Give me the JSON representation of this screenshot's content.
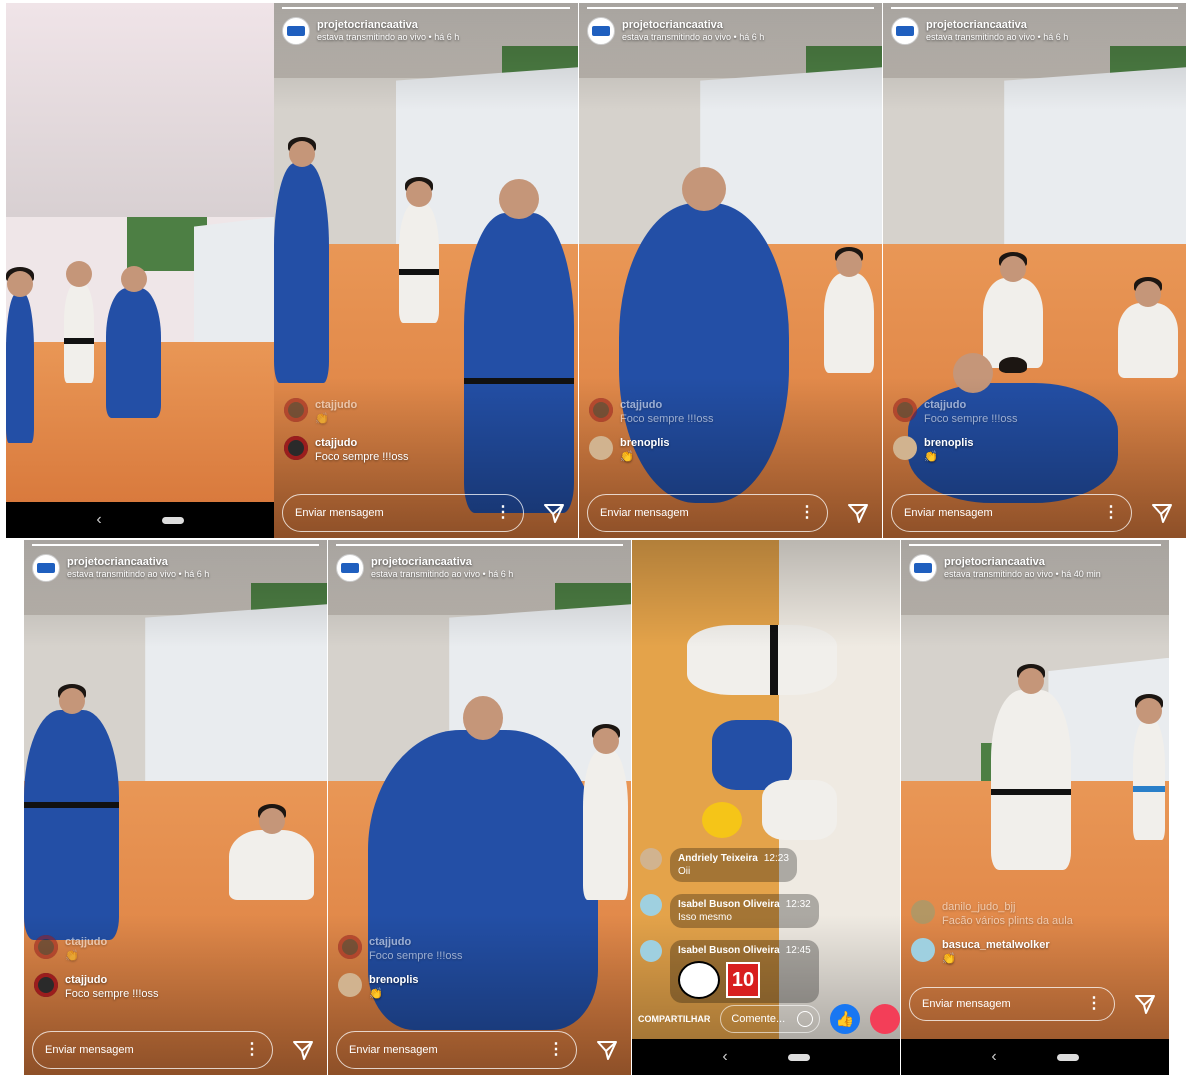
{
  "account": {
    "username": "projetocriancaativa",
    "status_6h": "estava transmitindo ao vivo • há 6 h",
    "status_40m": "estava transmitindo ao vivo • há 40 min"
  },
  "composer": {
    "placeholder": "Enviar mensagem"
  },
  "panel2": {
    "comments": [
      {
        "user": "ctajjudo",
        "text": "👏"
      },
      {
        "user": "ctajjudo",
        "text": "Foco sempre !!!oss"
      }
    ]
  },
  "panel3": {
    "comments": [
      {
        "user": "ctajjudo",
        "text": "Foco sempre !!!oss"
      },
      {
        "user": "brenoplis",
        "text": "👏"
      }
    ]
  },
  "panel4": {
    "comments": [
      {
        "user": "ctajjudo",
        "text": "Foco sempre !!!oss"
      },
      {
        "user": "brenoplis",
        "text": "👏"
      }
    ]
  },
  "panel5": {
    "comments": [
      {
        "user": "ctajjudo",
        "text": "👏"
      },
      {
        "user": "ctajjudo",
        "text": "Foco sempre !!!oss"
      }
    ]
  },
  "panel6": {
    "comments": [
      {
        "user": "ctajjudo",
        "text": "Foco sempre !!!oss"
      },
      {
        "user": "brenoplis",
        "text": "👏"
      }
    ]
  },
  "facebook": {
    "comments": [
      {
        "user": "Andriely Teixeira",
        "time": "12:23",
        "text": "Oii"
      },
      {
        "user": "Isabel Buson Oliveira",
        "time": "12:32",
        "text": "Isso mesmo"
      },
      {
        "user": "Isabel Buson Oliveira",
        "time": "12:45",
        "sticker_text": "10"
      }
    ],
    "share_label": "COMPARTILHAR",
    "comment_placeholder": "Comente...",
    "like_icon": "👍"
  },
  "panel8": {
    "comments": [
      {
        "user": "danilo_judo_bjj",
        "text": "Facão vários plints da aula"
      },
      {
        "user": "basuca_metalwolker",
        "text": "👏"
      }
    ]
  },
  "nav": {
    "back": "‹"
  }
}
